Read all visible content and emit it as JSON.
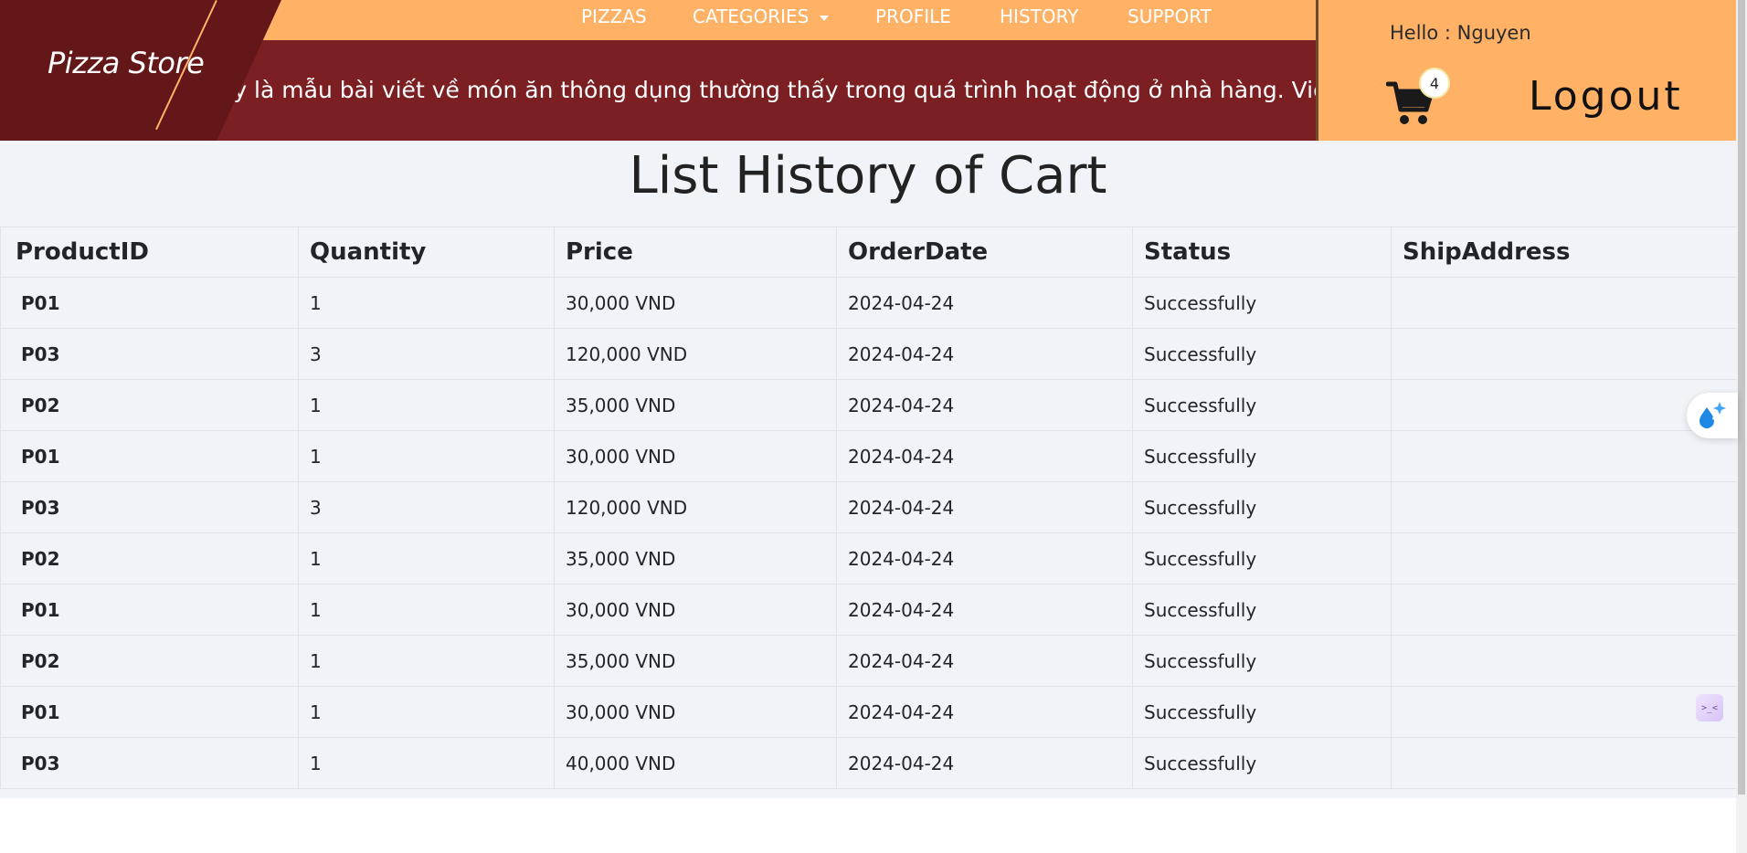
{
  "header": {
    "brand": "Pizza Store",
    "nav": {
      "pizzas": "PIZZAS",
      "categories": "CATEGORIES",
      "profile": "PROFILE",
      "history": "HISTORY",
      "support": "SUPPORT"
    },
    "marquee": "ây là mẫu bài viết về món ăn thông dụng thường thấy trong quá trình hoạt động ở nhà hàng. Việ",
    "greeting": "Hello : Nguyen",
    "cart_count": "4",
    "logout": "Logout"
  },
  "page": {
    "title": "List History of Cart"
  },
  "table": {
    "headers": {
      "product": "ProductID",
      "quantity": "Quantity",
      "price": "Price",
      "date": "OrderDate",
      "status": "Status",
      "address": "ShipAddress"
    },
    "rows": [
      {
        "product": "P01",
        "quantity": "1",
        "price": "30,000 VND",
        "date": "2024-04-24",
        "status": "Successfully",
        "address": ""
      },
      {
        "product": "P03",
        "quantity": "3",
        "price": "120,000 VND",
        "date": "2024-04-24",
        "status": "Successfully",
        "address": ""
      },
      {
        "product": "P02",
        "quantity": "1",
        "price": "35,000 VND",
        "date": "2024-04-24",
        "status": "Successfully",
        "address": ""
      },
      {
        "product": "P01",
        "quantity": "1",
        "price": "30,000 VND",
        "date": "2024-04-24",
        "status": "Successfully",
        "address": ""
      },
      {
        "product": "P03",
        "quantity": "3",
        "price": "120,000 VND",
        "date": "2024-04-24",
        "status": "Successfully",
        "address": ""
      },
      {
        "product": "P02",
        "quantity": "1",
        "price": "35,000 VND",
        "date": "2024-04-24",
        "status": "Successfully",
        "address": ""
      },
      {
        "product": "P01",
        "quantity": "1",
        "price": "30,000 VND",
        "date": "2024-04-24",
        "status": "Successfully",
        "address": ""
      },
      {
        "product": "P02",
        "quantity": "1",
        "price": "35,000 VND",
        "date": "2024-04-24",
        "status": "Successfully",
        "address": ""
      },
      {
        "product": "P01",
        "quantity": "1",
        "price": "30,000 VND",
        "date": "2024-04-24",
        "status": "Successfully",
        "address": ""
      },
      {
        "product": "P03",
        "quantity": "1",
        "price": "40,000 VND",
        "date": "2024-04-24",
        "status": "Successfully",
        "address": ""
      }
    ]
  },
  "floating": {
    "small_widget_glyph": ">_<"
  },
  "colors": {
    "nav_orange": "#ffb266",
    "banner_maroon": "#7c1f22",
    "brand_maroon": "#641719",
    "content_bg": "#f0f4f8"
  },
  "icons": [
    "cart-icon",
    "assistant-droplet-icon"
  ]
}
